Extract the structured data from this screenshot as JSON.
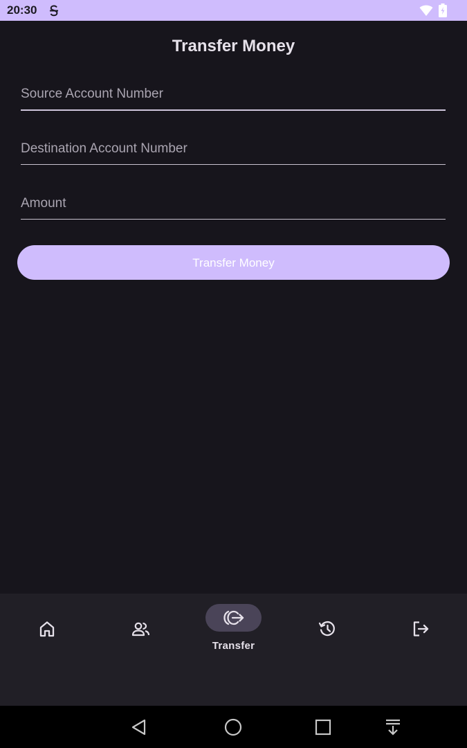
{
  "status_bar": {
    "time": "20:30",
    "app_icon": "s-strike-icon",
    "wifi_icon": "wifi-icon",
    "battery_icon": "battery-icon"
  },
  "page": {
    "title": "Transfer Money"
  },
  "form": {
    "source_placeholder": "Source Account Number",
    "source_value": "",
    "destination_placeholder": "Destination Account Number",
    "destination_value": "",
    "amount_placeholder": "Amount",
    "amount_value": "",
    "submit_label": "Transfer Money"
  },
  "bottom_nav": {
    "items": [
      {
        "icon": "home-icon",
        "label": ""
      },
      {
        "icon": "people-icon",
        "label": ""
      },
      {
        "icon": "transfer-icon",
        "label": "Transfer",
        "selected": true
      },
      {
        "icon": "history-icon",
        "label": ""
      },
      {
        "icon": "logout-icon",
        "label": ""
      }
    ]
  },
  "colors": {
    "accent": "#cfbcfd",
    "background": "#17151c",
    "nav_background": "#211f26",
    "nav_selected_pill": "#4a4458"
  }
}
